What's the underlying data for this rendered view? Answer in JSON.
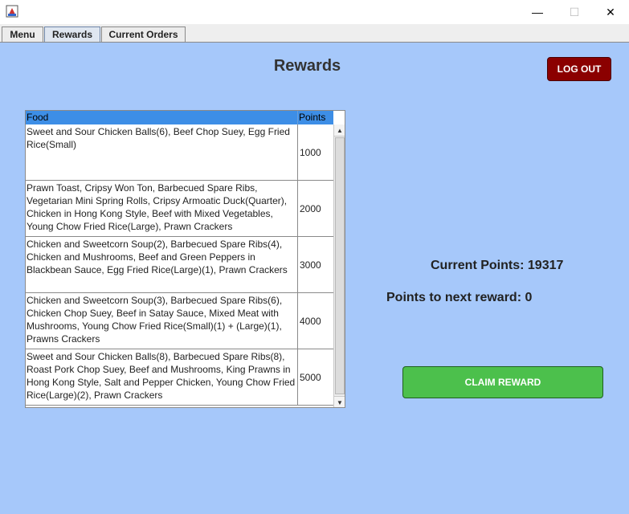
{
  "window": {
    "controls": {
      "minimize": "—",
      "maximize": "☐",
      "close": "✕"
    }
  },
  "tabs": [
    {
      "label": "Menu"
    },
    {
      "label": "Rewards",
      "selected": true
    },
    {
      "label": "Current Orders"
    }
  ],
  "page": {
    "title": "Rewards",
    "logout_label": "LOG OUT",
    "current_points_text": "Current Points: 19317",
    "next_reward_text": "Points to next reward: 0",
    "claim_label": "CLAIM REWARD"
  },
  "table": {
    "columns": [
      "Food",
      "Points"
    ],
    "rows": [
      {
        "food": "Sweet and Sour Chicken Balls(6), Beef Chop Suey, Egg Fried Rice(Small)",
        "points": "1000"
      },
      {
        "food": "Prawn Toast, Cripsy Won Ton, Barbecued Spare Ribs, Vegetarian Mini Spring Rolls, Cripsy Armoatic Duck(Quarter), Chicken in Hong Kong Style, Beef with Mixed Vegetables, Young Chow Fried Rice(Large), Prawn Crackers",
        "points": "2000"
      },
      {
        "food": "Chicken and Sweetcorn Soup(2), Barbecued Spare Ribs(4), Chicken and Mushrooms, Beef and Green Peppers in Blackbean Sauce, Egg Fried Rice(Large)(1), Prawn Crackers",
        "points": "3000"
      },
      {
        "food": "Chicken and Sweetcorn Soup(3), Barbecued Spare Ribs(6), Chicken Chop Suey, Beef in Satay Sauce, Mixed Meat with Mushrooms, Young Chow Fried Rice(Small)(1) + (Large)(1), Prawns Crackers",
        "points": "4000"
      },
      {
        "food": "Sweet and Sour Chicken Balls(8), Barbecued Spare Ribs(8), Roast Pork Chop Suey, Beef and Mushrooms, King Prawns in Hong Kong Style, Salt and Pepper Chicken, Young Chow Fried Rice(Large)(2), Prawn Crackers",
        "points": "5000"
      }
    ]
  },
  "colors": {
    "panel": "#a6c8fa",
    "header": "#3d8ee6",
    "logout": "#8b0000",
    "claim": "#4cc04c"
  }
}
